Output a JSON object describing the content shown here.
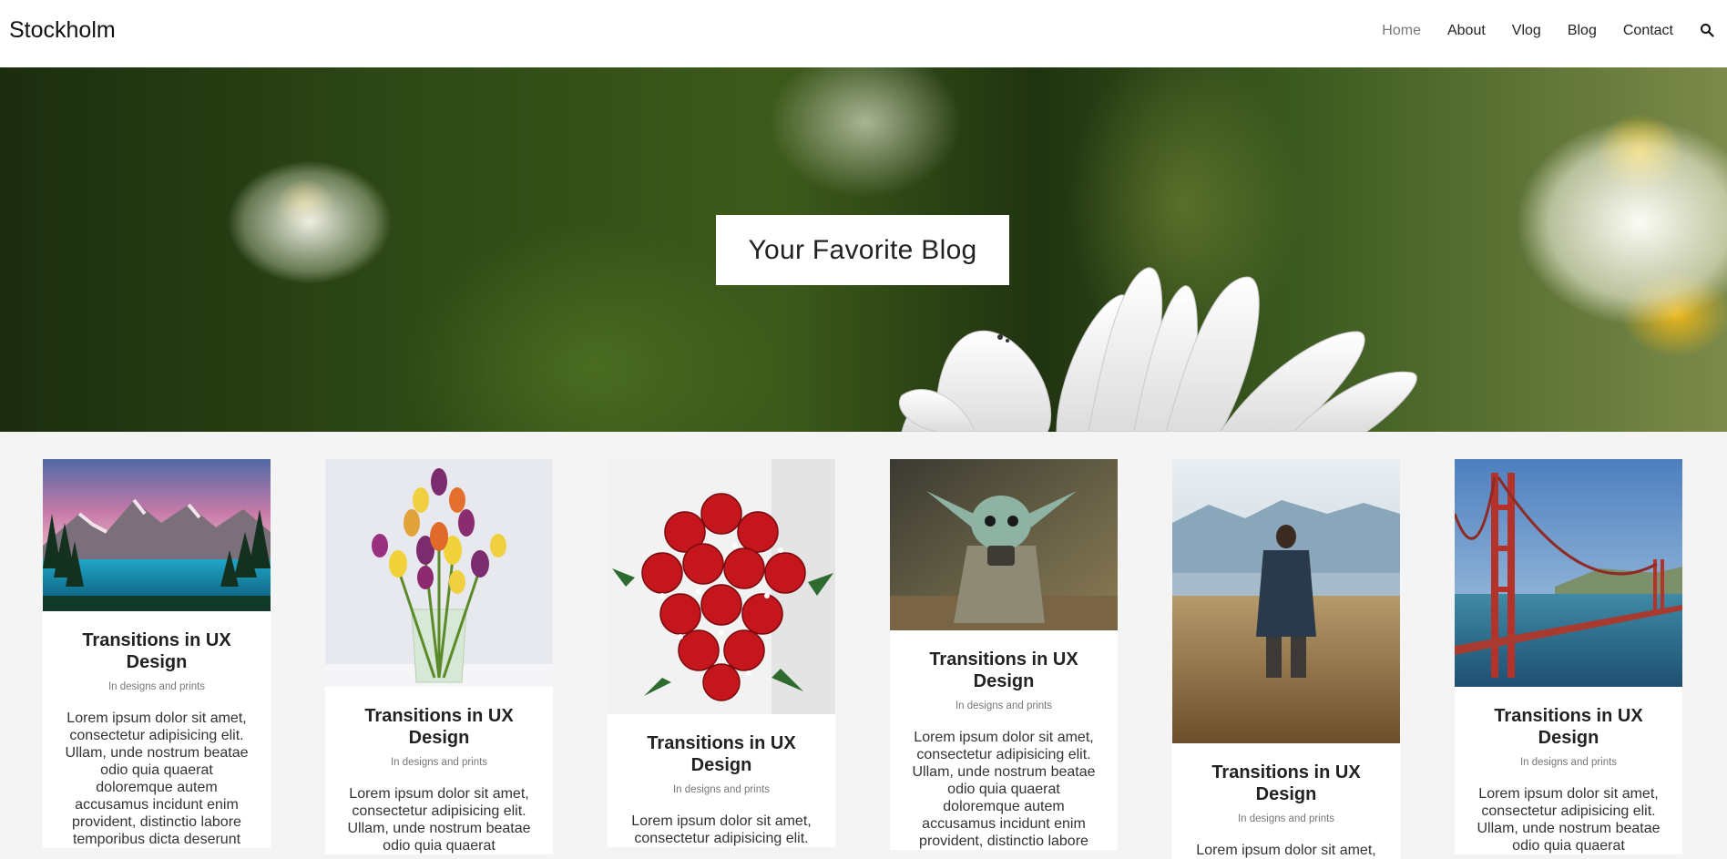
{
  "header": {
    "brand": "Stockholm",
    "nav": [
      "Home",
      "About",
      "Vlog",
      "Blog",
      "Contact"
    ],
    "active_nav": "Home",
    "search_icon": "search-icon"
  },
  "hero": {
    "title": "Your Favorite Blog"
  },
  "posts": [
    {
      "image": "mountain-lake-photo",
      "title": "Transitions in UX Design",
      "meta": "In designs and prints",
      "excerpt": "Lorem ipsum dolor sit amet, consectetur adipisicing elit. Ullam, unde nostrum beatae odio quia quaerat doloremque autem accusamus incidunt enim provident, distinctio labore temporibus dicta deserunt"
    },
    {
      "image": "tulips-vase-photo",
      "title": "Transitions in UX Design",
      "meta": "In designs and prints",
      "excerpt": "Lorem ipsum dolor sit amet, consectetur adipisicing elit. Ullam, unde nostrum beatae odio quia quaerat"
    },
    {
      "image": "red-roses-photo",
      "title": "Transitions in UX Design",
      "meta": "In designs and prints",
      "excerpt": "Lorem ipsum dolor sit amet, consectetur adipisicing elit."
    },
    {
      "image": "baby-yoda-photo",
      "title": "Transitions in UX Design",
      "meta": "In designs and prints",
      "excerpt": "Lorem ipsum dolor sit amet, consectetur adipisicing elit. Ullam, unde nostrum beatae odio quia quaerat doloremque autem accusamus incidunt enim provident, distinctio labore"
    },
    {
      "image": "man-in-field-photo",
      "title": "Transitions in UX Design",
      "meta": "In designs and prints",
      "excerpt": "Lorem ipsum dolor sit amet,"
    },
    {
      "image": "golden-gate-bridge-photo",
      "title": "Transitions in UX Design",
      "meta": "In designs and prints",
      "excerpt": "Lorem ipsum dolor sit amet, consectetur adipisicing elit. Ullam, unde nostrum beatae odio quia quaerat"
    }
  ]
}
